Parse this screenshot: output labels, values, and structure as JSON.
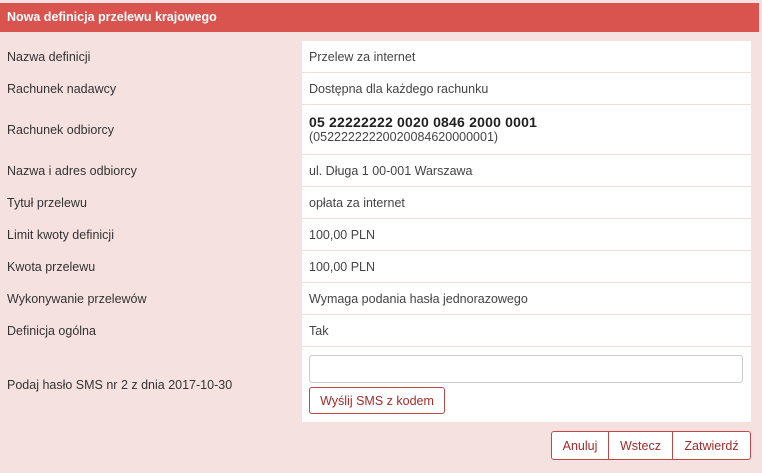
{
  "header": {
    "title": "Nowa definicja przelewu krajowego"
  },
  "fields": {
    "definition_name": {
      "label": "Nazwa definicji",
      "value": "Przelew za internet"
    },
    "sender_account": {
      "label": "Rachunek nadawcy",
      "value": "Dostępna dla każdego rachunku"
    },
    "recipient_account": {
      "label": "Rachunek odbiorcy",
      "value": "05 22222222 0020 0846 2000 0001",
      "value_raw": "(05222222220020084620000001)"
    },
    "recipient_name": {
      "label": "Nazwa i adres odbiorcy",
      "value": "ul. Długa 1 00-001 Warszawa"
    },
    "title": {
      "label": "Tytuł przelewu",
      "value": "opłata za internet"
    },
    "limit": {
      "label": "Limit kwoty definicji",
      "value": "100,00 PLN"
    },
    "amount": {
      "label": "Kwota przelewu",
      "value": "100,00 PLN"
    },
    "execution": {
      "label": "Wykonywanie przelewów",
      "value": "Wymaga podania hasła jednorazowego"
    },
    "general": {
      "label": "Definicja ogólna",
      "value": "Tak"
    },
    "sms": {
      "label": "Podaj hasło SMS nr 2 z dnia 2017-10-30",
      "input_value": "",
      "send_label": "Wyślij SMS z kodem"
    }
  },
  "actions": {
    "cancel": "Anuluj",
    "back": "Wstecz",
    "confirm": "Zatwierdź"
  },
  "colors": {
    "header_bg": "#d9534f",
    "page_bg": "#f6e1e1",
    "button_text": "#a52a2a"
  }
}
